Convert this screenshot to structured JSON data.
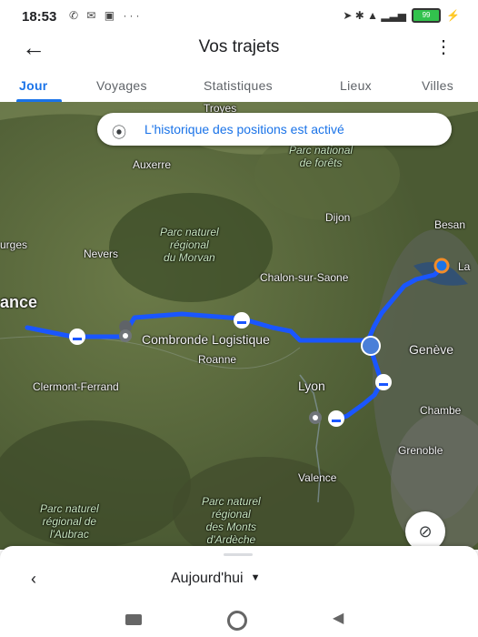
{
  "status_bar": {
    "time": "18:53",
    "left_icons": "✆ ✉ ▣ ···",
    "right_icons": "➤ ✱ ▲ ▂▃▅",
    "battery": "99"
  },
  "header": {
    "back_icon": "arrow-back-icon",
    "title": "Vos trajets",
    "menu_icon": "more-vert-icon"
  },
  "tabs": [
    {
      "label": "Jour",
      "active": true
    },
    {
      "label": "Voyages",
      "active": false
    },
    {
      "label": "Statistiques",
      "active": false
    },
    {
      "label": "Lieux",
      "active": false
    },
    {
      "label": "Villes",
      "active": false
    }
  ],
  "map": {
    "location_banner": "L'historique des positions est activé",
    "labels": {
      "troyes": "Troyes",
      "auxerre": "Auxerre",
      "park_forets": "Parc national\nde forêts",
      "dijon": "Dijon",
      "besancon": "Besan",
      "la": "La",
      "bourges": "urges",
      "nevers": "Nevers",
      "park_morvan": "Parc naturel\nrégional\ndu Morvan",
      "chalon": "Chalon-sur-Saone",
      "france": "ance",
      "combronde": "Combronde Logistique",
      "roanne": "Roanne",
      "geneve": "Genève",
      "clermont": "Clermont-Ferrand",
      "lyon": "Lyon",
      "chambery": "Chambe",
      "grenoble": "Grenoble",
      "valence": "Valence",
      "park_aubrac": "Parc naturel\nrégional de\nl'Aubrac",
      "park_ardeche": "Parc naturel\nrégional\ndes Monts\nd'Ardèche"
    },
    "route_color": "#1a56ff",
    "layers_icon": "layers-off-icon"
  },
  "bottom_sheet": {
    "prev_icon": "chevron-left-icon",
    "date_label": "Aujourd'hui",
    "dropdown_icon": "caret-down-icon"
  },
  "nav_bar": {
    "recent_icon": "square-icon",
    "home_icon": "circle-icon",
    "back_icon": "triangle-back-icon"
  }
}
